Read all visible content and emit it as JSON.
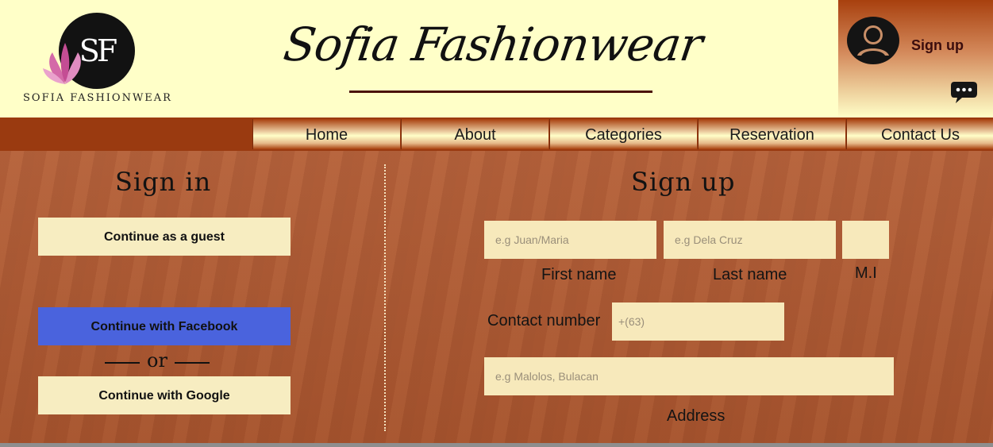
{
  "header": {
    "logo_monogram": "SF",
    "logo_text": "SOFIA FASHIONWEAR",
    "brand_title": "Sofia Fashionwear",
    "signup_link": "Sign up",
    "avatar_icon": "user-avatar-icon",
    "chat_icon": "chat-bubble-icon"
  },
  "nav": {
    "items": [
      "Home",
      "About",
      "Categories",
      "Reservation",
      "Contact Us"
    ]
  },
  "signin": {
    "title": "Sign in",
    "guest_button": "Continue as a guest",
    "facebook_button": "Continue with Facebook",
    "or_text": "or",
    "google_button": "Continue with Google"
  },
  "signup": {
    "title": "Sign up",
    "first_name": {
      "placeholder": "e.g Juan/Maria",
      "label": "First name"
    },
    "last_name": {
      "placeholder": "e.g Dela Cruz",
      "label": "Last name"
    },
    "middle_initial": {
      "placeholder": "",
      "label": "M.I"
    },
    "contact": {
      "label": "Contact number",
      "placeholder": "+(63)"
    },
    "address": {
      "placeholder": "e.g Malolos, Bulacan",
      "label": "Address"
    }
  },
  "colors": {
    "header_bg": "#ffffc8",
    "nav_bar": "#9a3a10",
    "facebook_blue": "#4a63dd",
    "field_bg": "#f7e9bb",
    "button_bg": "#f7edc1"
  }
}
